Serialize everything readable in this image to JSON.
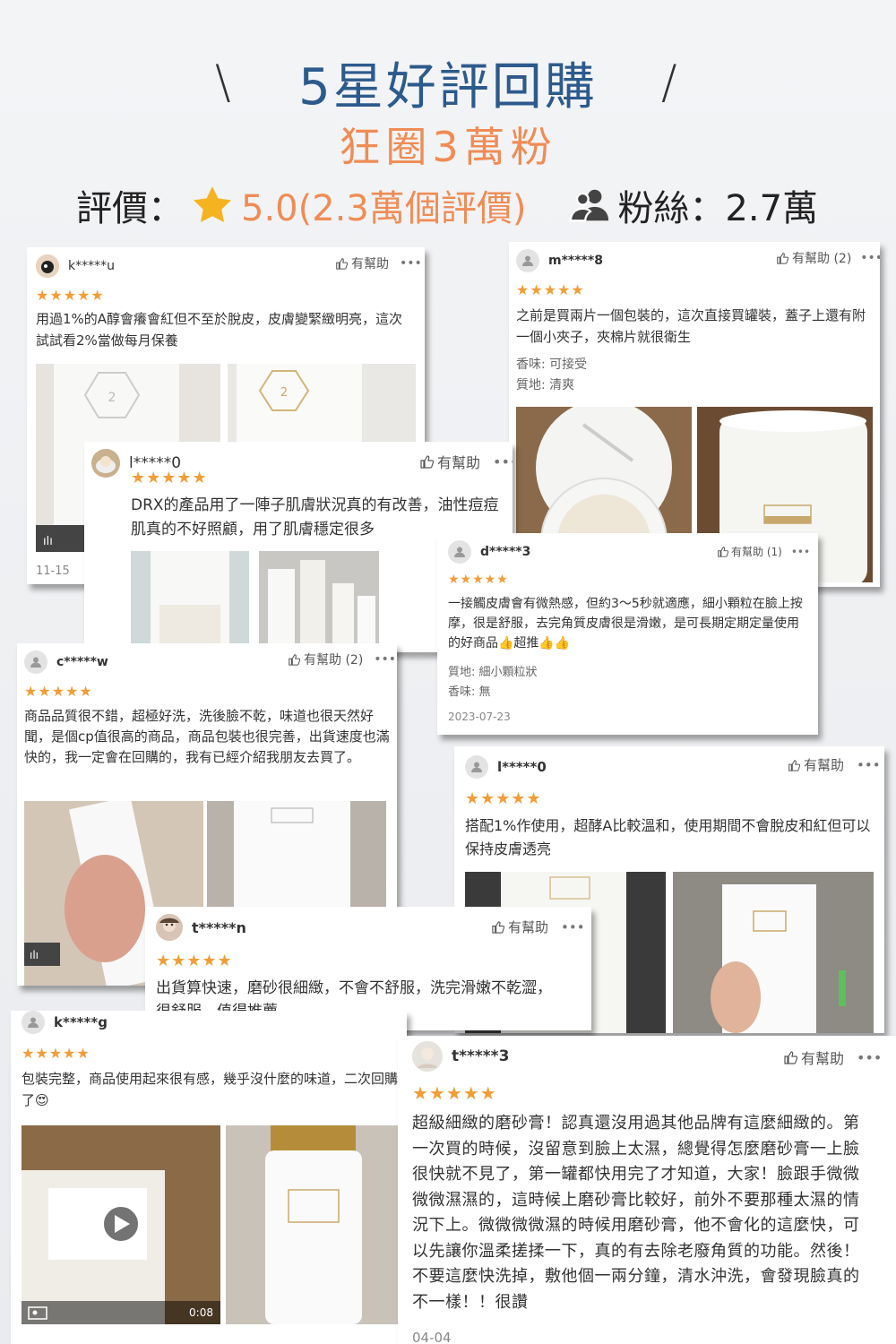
{
  "header": {
    "title": "5星好評回購",
    "subtitle": "狂圈3萬粉",
    "rating_label": "評價：",
    "rating_value": "5.0(2.3萬個評價)",
    "fans_label": "粉絲：2.7萬"
  },
  "colors": {
    "title": "#2c5a8c",
    "accent": "#ef8c55",
    "star": "#f29d38"
  },
  "reviews": [
    {
      "user": "k*****u",
      "helpful": "有幫助",
      "stars": "★★★★★",
      "text": "用過1%的A醇會癢會紅但不至於脫皮，皮膚變緊緻明亮，這次試試看2%當做每月保養",
      "date": "11-15"
    },
    {
      "user": "m*****8",
      "helpful": "有幫助 (2)",
      "stars": "★★★★★",
      "text": "之前是買兩片一個包裝的，這次直接買罐裝，蓋子上還有附一個小夾子，夾棉片就很衛生",
      "scent": "香味: 可接受",
      "texture": "質地: 清爽"
    },
    {
      "user": "l*****0",
      "helpful": "有幫助",
      "stars": "★★★★★",
      "text": "DRX的產品用了一陣子肌膚狀況真的有改善，油性痘痘肌真的不好照顧，用了肌膚穩定很多"
    },
    {
      "user": "d*****3",
      "helpful": "有幫助 (1)",
      "stars": "★★★★★",
      "text": "一接觸皮膚會有微熱感，但約3～5秒就適應，細小顆粒在臉上按摩，很是舒服，去完角質皮膚很是滑嫩，是可長期定期定量使用的好商品👍超推👍👍",
      "texture": "質地: 細小顆粒狀",
      "scent": "香味: 無",
      "date": "2023-07-23"
    },
    {
      "user": "c*****w",
      "helpful": "有幫助 (2)",
      "stars": "★★★★★",
      "text": "商品品質很不錯，超極好洗，洗後臉不乾，味道也很天然好聞，是個cp值很高的商品，商品包裝也很完善，出貨速度也滿快的，我一定會在回購的，我有已經介紹我朋友去買了。"
    },
    {
      "user": "l*****0",
      "helpful": "有幫助",
      "stars": "★★★★★",
      "text": "搭配1%作使用，超酵A比較溫和，使用期間不會脫皮和紅但可以保持皮膚透亮"
    },
    {
      "user": "t*****n",
      "helpful": "有幫助",
      "stars": "★★★★★",
      "text": "出貨算快速，磨砂很細緻，不會不舒服，洗完滑嫩不乾澀，很舒服，值得推薦。"
    },
    {
      "user": "k*****g",
      "helpful": "有幫助",
      "stars": "★★★★★",
      "text": "包裝完整，商品使用起來很有感，幾乎沒什麼的味道，二次回購了😍",
      "video_time": "0:08"
    },
    {
      "user": "t*****3",
      "helpful": "有幫助",
      "stars": "★★★★★",
      "text": "超級細緻的磨砂膏！認真還沒用過其他品牌有這麼細緻的。第一次買的時候，沒留意到臉上太濕，總覺得怎麼磨砂膏一上臉很快就不見了，第一罐都快用完了才知道，大家！臉跟手微微微微濕濕的，這時候上磨砂膏比較好，前外不要那種太濕的情況下上。微微微微濕的時候用磨砂膏，他不會化的這麼快，可以先讓你溫柔搓揉一下，真的有去除老廢角質的功能。然後！不要這麼快洗掉，敷他個一兩分鐘，清水沖洗，會發現臉真的不一樣！！很讚",
      "date": "04-04"
    }
  ],
  "icons": {
    "more": "•••",
    "thumb": "thumb-up-icon"
  }
}
